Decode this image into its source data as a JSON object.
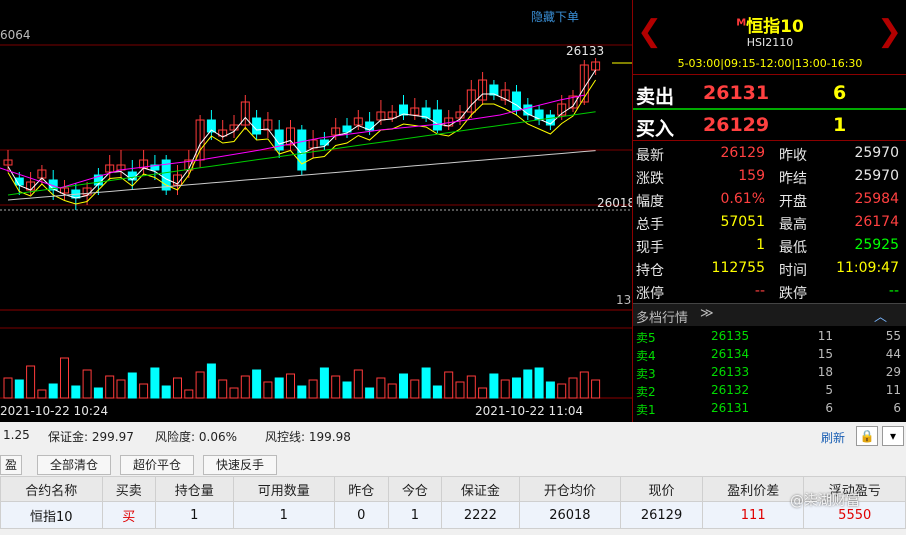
{
  "chart": {
    "hide_order_label": "隐藏下单",
    "top_left_value": "6064",
    "high_label": "26133",
    "avg_label": "26018",
    "vol_axis_label": "13",
    "time_start": "2021-10-22 10:24",
    "time_end": "2021-10-22 11:04",
    "colors": {
      "up": "#ff3b3b",
      "down": "#00ffff",
      "ma5": "#ffffff",
      "ma10": "#ffff00",
      "ma20": "#ff00ff",
      "ma60": "#00cc00"
    }
  },
  "quote": {
    "name_prefix": "M",
    "name": "恒指10",
    "code": "HSI2110",
    "session": "5-03:00|09:15-12:00|13:00-16:30",
    "sell_label": "卖出",
    "sell_price": "26131",
    "sell_qty": "6",
    "buy_label": "买入",
    "buy_price": "26129",
    "buy_qty": "1",
    "fields": [
      {
        "l1": "最新",
        "v1": "26129",
        "c1": "#ff4040",
        "l2": "昨收",
        "v2": "25970",
        "c2": "#e6e6e6"
      },
      {
        "l1": "涨跌",
        "v1": "159",
        "c1": "#ff4040",
        "l2": "昨结",
        "v2": "25970",
        "c2": "#e6e6e6"
      },
      {
        "l1": "幅度",
        "v1": "0.61%",
        "c1": "#ff4040",
        "l2": "开盘",
        "v2": "25984",
        "c2": "#ff4040"
      },
      {
        "l1": "总手",
        "v1": "57051",
        "c1": "#ffff00",
        "l2": "最高",
        "v2": "26174",
        "c2": "#ff4040"
      },
      {
        "l1": "现手",
        "v1": "1",
        "c1": "#ffff00",
        "l2": "最低",
        "v2": "25925",
        "c2": "#00ff00"
      },
      {
        "l1": "持仓",
        "v1": "112755",
        "c1": "#ffff00",
        "l2": "时间",
        "v2": "11:09:47",
        "c2": "#ffff00"
      },
      {
        "l1": "涨停",
        "v1": "--",
        "c1": "#ff4040",
        "l2": "跌停",
        "v2": "--",
        "c2": "#00ff00"
      }
    ],
    "depth_title": "多档行情",
    "depth": [
      {
        "label": "卖5",
        "price": "26135",
        "qty": "11",
        "extra": "55"
      },
      {
        "label": "卖4",
        "price": "26134",
        "qty": "15",
        "extra": "44"
      },
      {
        "label": "卖3",
        "price": "26133",
        "qty": "18",
        "extra": "29"
      },
      {
        "label": "卖2",
        "price": "26132",
        "qty": "5",
        "extra": "11"
      },
      {
        "label": "卖1",
        "price": "26131",
        "qty": "6",
        "extra": "6"
      }
    ]
  },
  "account": {
    "left_value": "1.25",
    "margin_label": "保证金:",
    "margin_value": "299.97",
    "risk_label": "风险度:",
    "risk_value": "0.06%",
    "risk_line_label": "风控线:",
    "risk_line_value": "199.98",
    "refresh": "刷新"
  },
  "actions": {
    "tab_partial": "盈",
    "close_all": "全部清仓",
    "super_close": "超价平仓",
    "quick_reverse": "快速反手"
  },
  "positions": {
    "headers": [
      "合约名称",
      "买卖",
      "持仓量",
      "可用数量",
      "昨仓",
      "今仓",
      "保证金",
      "开仓均价",
      "现价",
      "盈利价差",
      "浮动盈亏"
    ],
    "rows": [
      [
        "恒指10",
        "买",
        "1",
        "1",
        "0",
        "1",
        "2222",
        "26018",
        "26129",
        "111",
        "5550"
      ]
    ]
  },
  "watermark": "@柒湖财富"
}
